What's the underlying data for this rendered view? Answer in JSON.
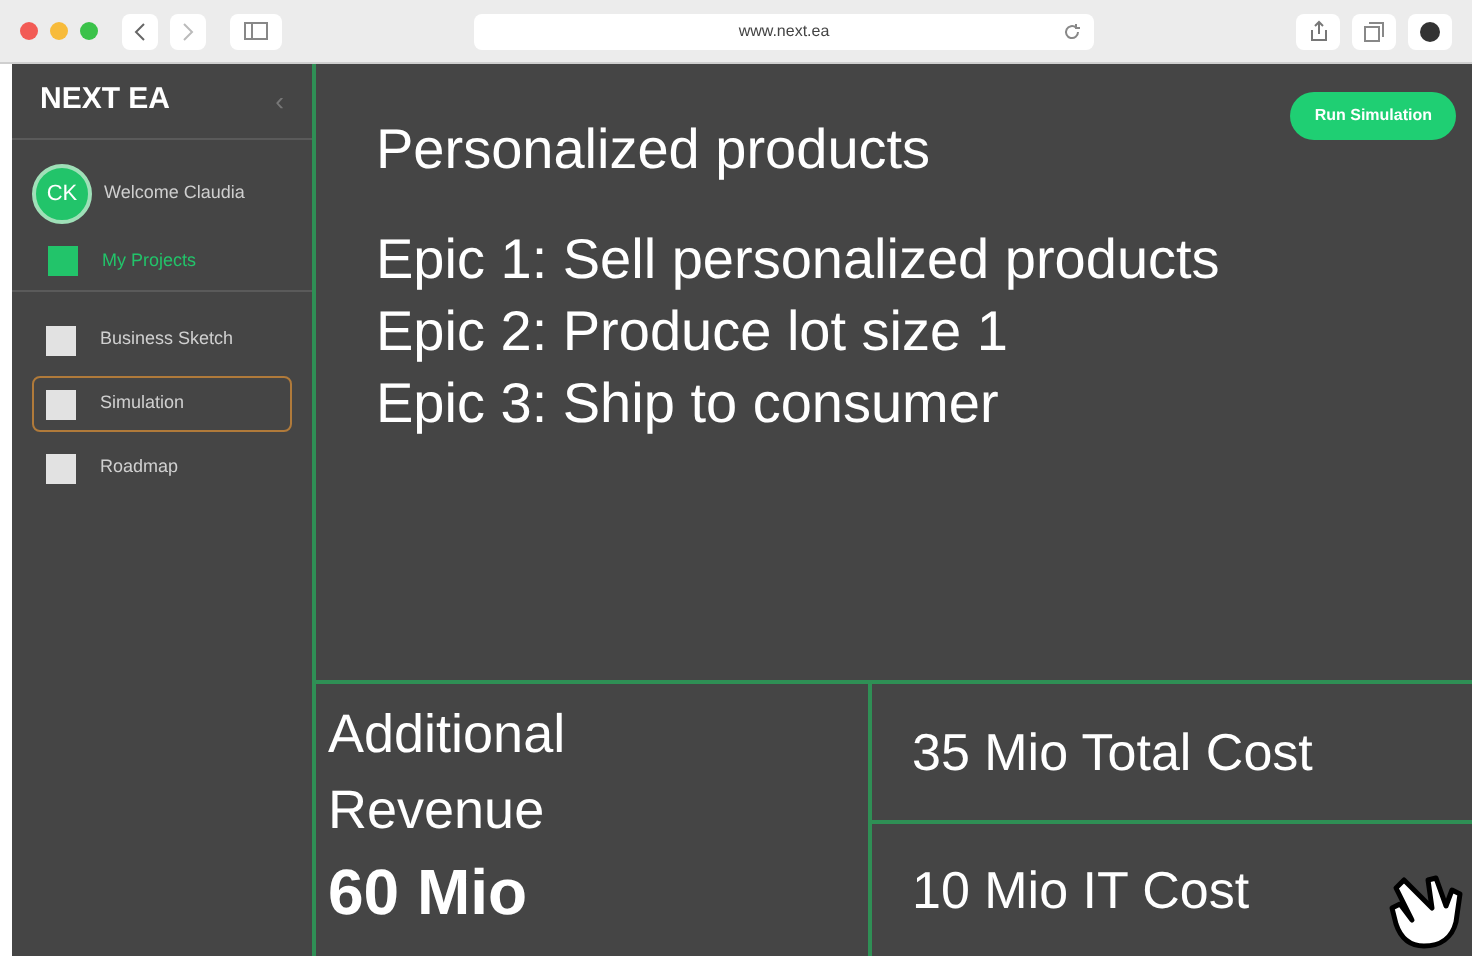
{
  "browser": {
    "url": "www.next.ea"
  },
  "sidebar": {
    "title": "NEXT EA",
    "collapse": "‹",
    "user": {
      "initials": "CK",
      "greeting": "Welcome Claudia"
    },
    "section": "My Projects",
    "items": [
      {
        "label": "Business Sketch",
        "selected": false
      },
      {
        "label": "Simulation",
        "selected": true
      },
      {
        "label": "Roadmap",
        "selected": false
      }
    ]
  },
  "main": {
    "title": "Personalized products",
    "run_button": "Run Simulation",
    "epics": [
      "Epic 1: Sell personalized products",
      "Epic 2: Produce lot size 1",
      "Epic 3: Ship to consumer"
    ]
  },
  "metrics": {
    "revenue_label": "Additional Revenue",
    "revenue_value": "60 Mio",
    "total_cost": "35 Mio Total Cost",
    "it_cost": "10 Mio IT Cost"
  }
}
